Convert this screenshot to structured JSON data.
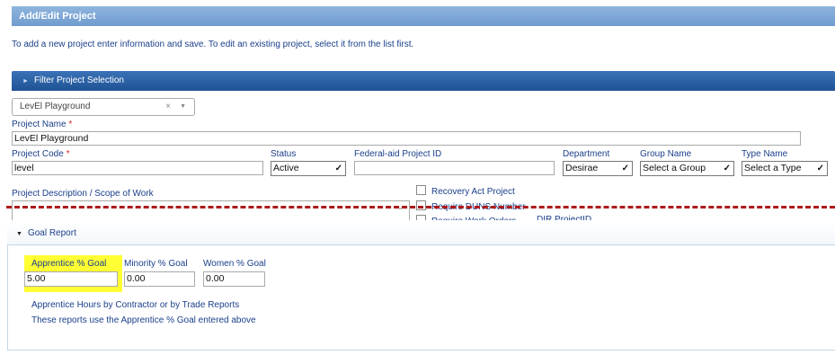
{
  "header": {
    "title": "Add/Edit Project",
    "instruction": "To add a new project enter information and save. To edit an existing project, select it from the list first."
  },
  "filter": {
    "label": "Filter Project Selection",
    "selected_project": "LevEl Playground"
  },
  "form": {
    "project_name_label": "Project Name",
    "project_name_value": "LevEl Playground",
    "project_code_label": "Project Code",
    "project_code_value": "level",
    "required_marker": "*",
    "status_label": "Status",
    "status_value": "Active",
    "federal_id_label": "Federal-aid Project ID",
    "federal_id_value": "",
    "department_label": "Department",
    "department_value": "Desirae",
    "group_label": "Group Name",
    "group_value": "Select a Group",
    "type_label": "Type Name",
    "type_value": "Select a Type",
    "description_label": "Project Description / Scope of Work",
    "checkboxes": [
      {
        "label": "Recovery Act Project",
        "checked": false
      },
      {
        "label": "Require DUNS Number",
        "checked": false
      },
      {
        "label": "Require Work Orders",
        "checked": false
      }
    ],
    "dir_project_label": "DIR ProjectID"
  },
  "goal_report": {
    "title": "Goal Report",
    "apprentice_label": "Apprentice % Goal",
    "apprentice_value": "5.00",
    "minority_label": "Minority % Goal",
    "minority_value": "0.00",
    "women_label": "Women % Goal",
    "women_value": "0.00",
    "note_line1": "Apprentice Hours by Contractor or by Trade Reports",
    "note_line2": "These reports use the Apprentice % Goal entered above"
  },
  "colors": {
    "title_bar": "#7ea9d8",
    "filter_bar": "#2b62a8",
    "label_text": "#1a3f8a",
    "required": "#e02020",
    "highlight": "#ffff33",
    "cut_line": "#b01a1a"
  },
  "icons": {
    "clear": "clear-icon",
    "dropdown": "chevron-down-icon",
    "expand": "chevron-right-icon",
    "collapse": "caret-down-icon"
  }
}
